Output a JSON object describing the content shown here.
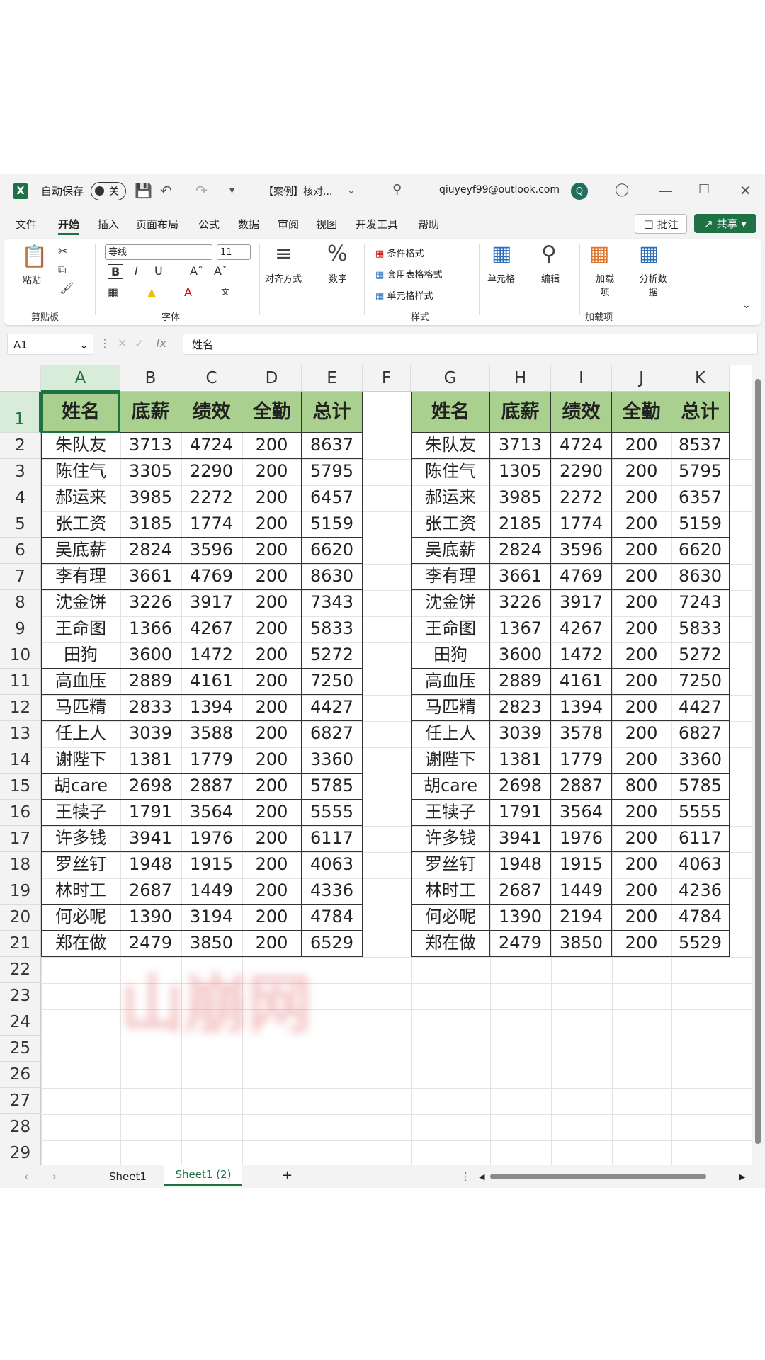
{
  "titlebar": {
    "autosave_label": "自动保存",
    "toggle_state": "关",
    "doc_title": "【案例】核对...",
    "email": "qiuyeyf99@outlook.com",
    "avatar_letter": "Q"
  },
  "menu": {
    "items": [
      "文件",
      "开始",
      "插入",
      "页面布局",
      "公式",
      "数据",
      "审阅",
      "视图",
      "开发工具",
      "帮助"
    ],
    "active": "开始",
    "comment_label": "批注",
    "share_label": "共享"
  },
  "ribbon": {
    "paste_label": "粘贴",
    "clipboard_group": "剪贴板",
    "font_name": "等线",
    "font_size": "11",
    "font_group": "字体",
    "align_label": "对齐方式",
    "number_label": "数字",
    "cond_format": "条件格式",
    "table_format": "套用表格格式",
    "cell_style": "单元格样式",
    "styles_group": "样式",
    "cells_label": "单元格",
    "edit_label": "编辑",
    "addins_label": "加载项",
    "addins_sub": "加载项",
    "analyze_label": "分析数据"
  },
  "formula_bar": {
    "cell_ref": "A1",
    "fx": "fx",
    "content": "姓名"
  },
  "grid": {
    "columns": [
      "A",
      "B",
      "C",
      "D",
      "E",
      "F",
      "G",
      "H",
      "I",
      "J",
      "K"
    ],
    "rows": [
      "1",
      "2",
      "3",
      "4",
      "5",
      "6",
      "7",
      "8",
      "9",
      "10",
      "11",
      "12",
      "13",
      "14",
      "15",
      "16",
      "17",
      "18",
      "19",
      "20",
      "21",
      "22",
      "23",
      "24",
      "25",
      "26",
      "27",
      "28",
      "29"
    ],
    "headers": [
      "姓名",
      "底薪",
      "绩效",
      "全勤",
      "总计"
    ],
    "table1": [
      [
        "朱队友",
        "3713",
        "4724",
        "200",
        "8637"
      ],
      [
        "陈住气",
        "3305",
        "2290",
        "200",
        "5795"
      ],
      [
        "郝运来",
        "3985",
        "2272",
        "200",
        "6457"
      ],
      [
        "张工资",
        "3185",
        "1774",
        "200",
        "5159"
      ],
      [
        "吴底薪",
        "2824",
        "3596",
        "200",
        "6620"
      ],
      [
        "李有理",
        "3661",
        "4769",
        "200",
        "8630"
      ],
      [
        "沈金饼",
        "3226",
        "3917",
        "200",
        "7343"
      ],
      [
        "王命图",
        "1366",
        "4267",
        "200",
        "5833"
      ],
      [
        "田狗",
        "3600",
        "1472",
        "200",
        "5272"
      ],
      [
        "高血压",
        "2889",
        "4161",
        "200",
        "7250"
      ],
      [
        "马匹精",
        "2833",
        "1394",
        "200",
        "4427"
      ],
      [
        "任上人",
        "3039",
        "3588",
        "200",
        "6827"
      ],
      [
        "谢陛下",
        "1381",
        "1779",
        "200",
        "3360"
      ],
      [
        "胡care",
        "2698",
        "2887",
        "200",
        "5785"
      ],
      [
        "王犊子",
        "1791",
        "3564",
        "200",
        "5555"
      ],
      [
        "许多钱",
        "3941",
        "1976",
        "200",
        "6117"
      ],
      [
        "罗丝钉",
        "1948",
        "1915",
        "200",
        "4063"
      ],
      [
        "林时工",
        "2687",
        "1449",
        "200",
        "4336"
      ],
      [
        "何必呢",
        "1390",
        "3194",
        "200",
        "4784"
      ],
      [
        "郑在做",
        "2479",
        "3850",
        "200",
        "6529"
      ]
    ],
    "table2": [
      [
        "朱队友",
        "3713",
        "4724",
        "200",
        "8537"
      ],
      [
        "陈住气",
        "1305",
        "2290",
        "200",
        "5795"
      ],
      [
        "郝运来",
        "3985",
        "2272",
        "200",
        "6357"
      ],
      [
        "张工资",
        "2185",
        "1774",
        "200",
        "5159"
      ],
      [
        "吴底薪",
        "2824",
        "3596",
        "200",
        "6620"
      ],
      [
        "李有理",
        "3661",
        "4769",
        "200",
        "8630"
      ],
      [
        "沈金饼",
        "3226",
        "3917",
        "200",
        "7243"
      ],
      [
        "王命图",
        "1367",
        "4267",
        "200",
        "5833"
      ],
      [
        "田狗",
        "3600",
        "1472",
        "200",
        "5272"
      ],
      [
        "高血压",
        "2889",
        "4161",
        "200",
        "7250"
      ],
      [
        "马匹精",
        "2823",
        "1394",
        "200",
        "4427"
      ],
      [
        "任上人",
        "3039",
        "3578",
        "200",
        "6827"
      ],
      [
        "谢陛下",
        "1381",
        "1779",
        "200",
        "3360"
      ],
      [
        "胡care",
        "2698",
        "2887",
        "800",
        "5785"
      ],
      [
        "王犊子",
        "1791",
        "3564",
        "200",
        "5555"
      ],
      [
        "许多钱",
        "3941",
        "1976",
        "200",
        "6117"
      ],
      [
        "罗丝钉",
        "1948",
        "1915",
        "200",
        "4063"
      ],
      [
        "林时工",
        "2687",
        "1449",
        "200",
        "4236"
      ],
      [
        "何必呢",
        "1390",
        "2194",
        "200",
        "4784"
      ],
      [
        "郑在做",
        "2479",
        "3850",
        "200",
        "5529"
      ]
    ],
    "header_fill": "#a9d08e",
    "selection_color": "#1e7145"
  },
  "sheet_tabs": {
    "tabs": [
      "Sheet1",
      "Sheet1 (2)"
    ],
    "active": "Sheet1 (2)",
    "add": "+"
  },
  "watermark": "山崩网"
}
